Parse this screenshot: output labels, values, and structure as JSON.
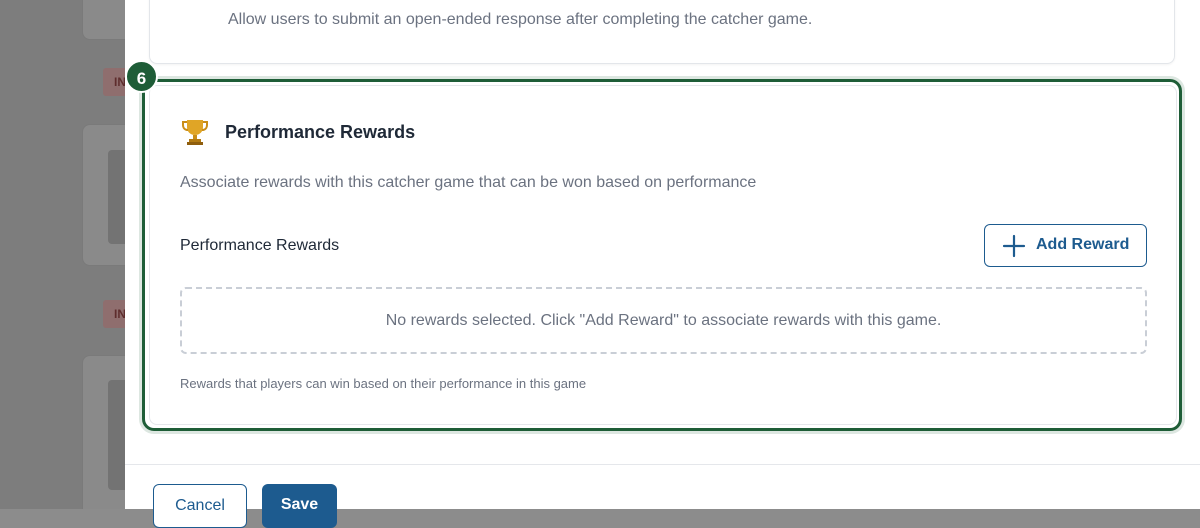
{
  "background": {
    "tags": [
      "IN",
      "IN"
    ]
  },
  "prev_section": {
    "description": "Allow users to submit an open-ended response after completing the catcher game."
  },
  "step": {
    "number": "6"
  },
  "rewards_section": {
    "icon": "trophy-icon",
    "title": "Performance Rewards",
    "description": "Associate rewards with this catcher game that can be won based on performance",
    "field_label": "Performance Rewards",
    "add_button": {
      "icon": "plus-icon",
      "label": "Add Reward"
    },
    "empty_state": "No rewards selected. Click \"Add Reward\" to associate rewards with this game.",
    "helper_text": "Rewards that players can win based on their performance in this game"
  },
  "footer": {
    "cancel_label": "Cancel",
    "save_label": "Save"
  },
  "colors": {
    "accent": "#1d5b8f",
    "highlight": "#1e5d37"
  }
}
